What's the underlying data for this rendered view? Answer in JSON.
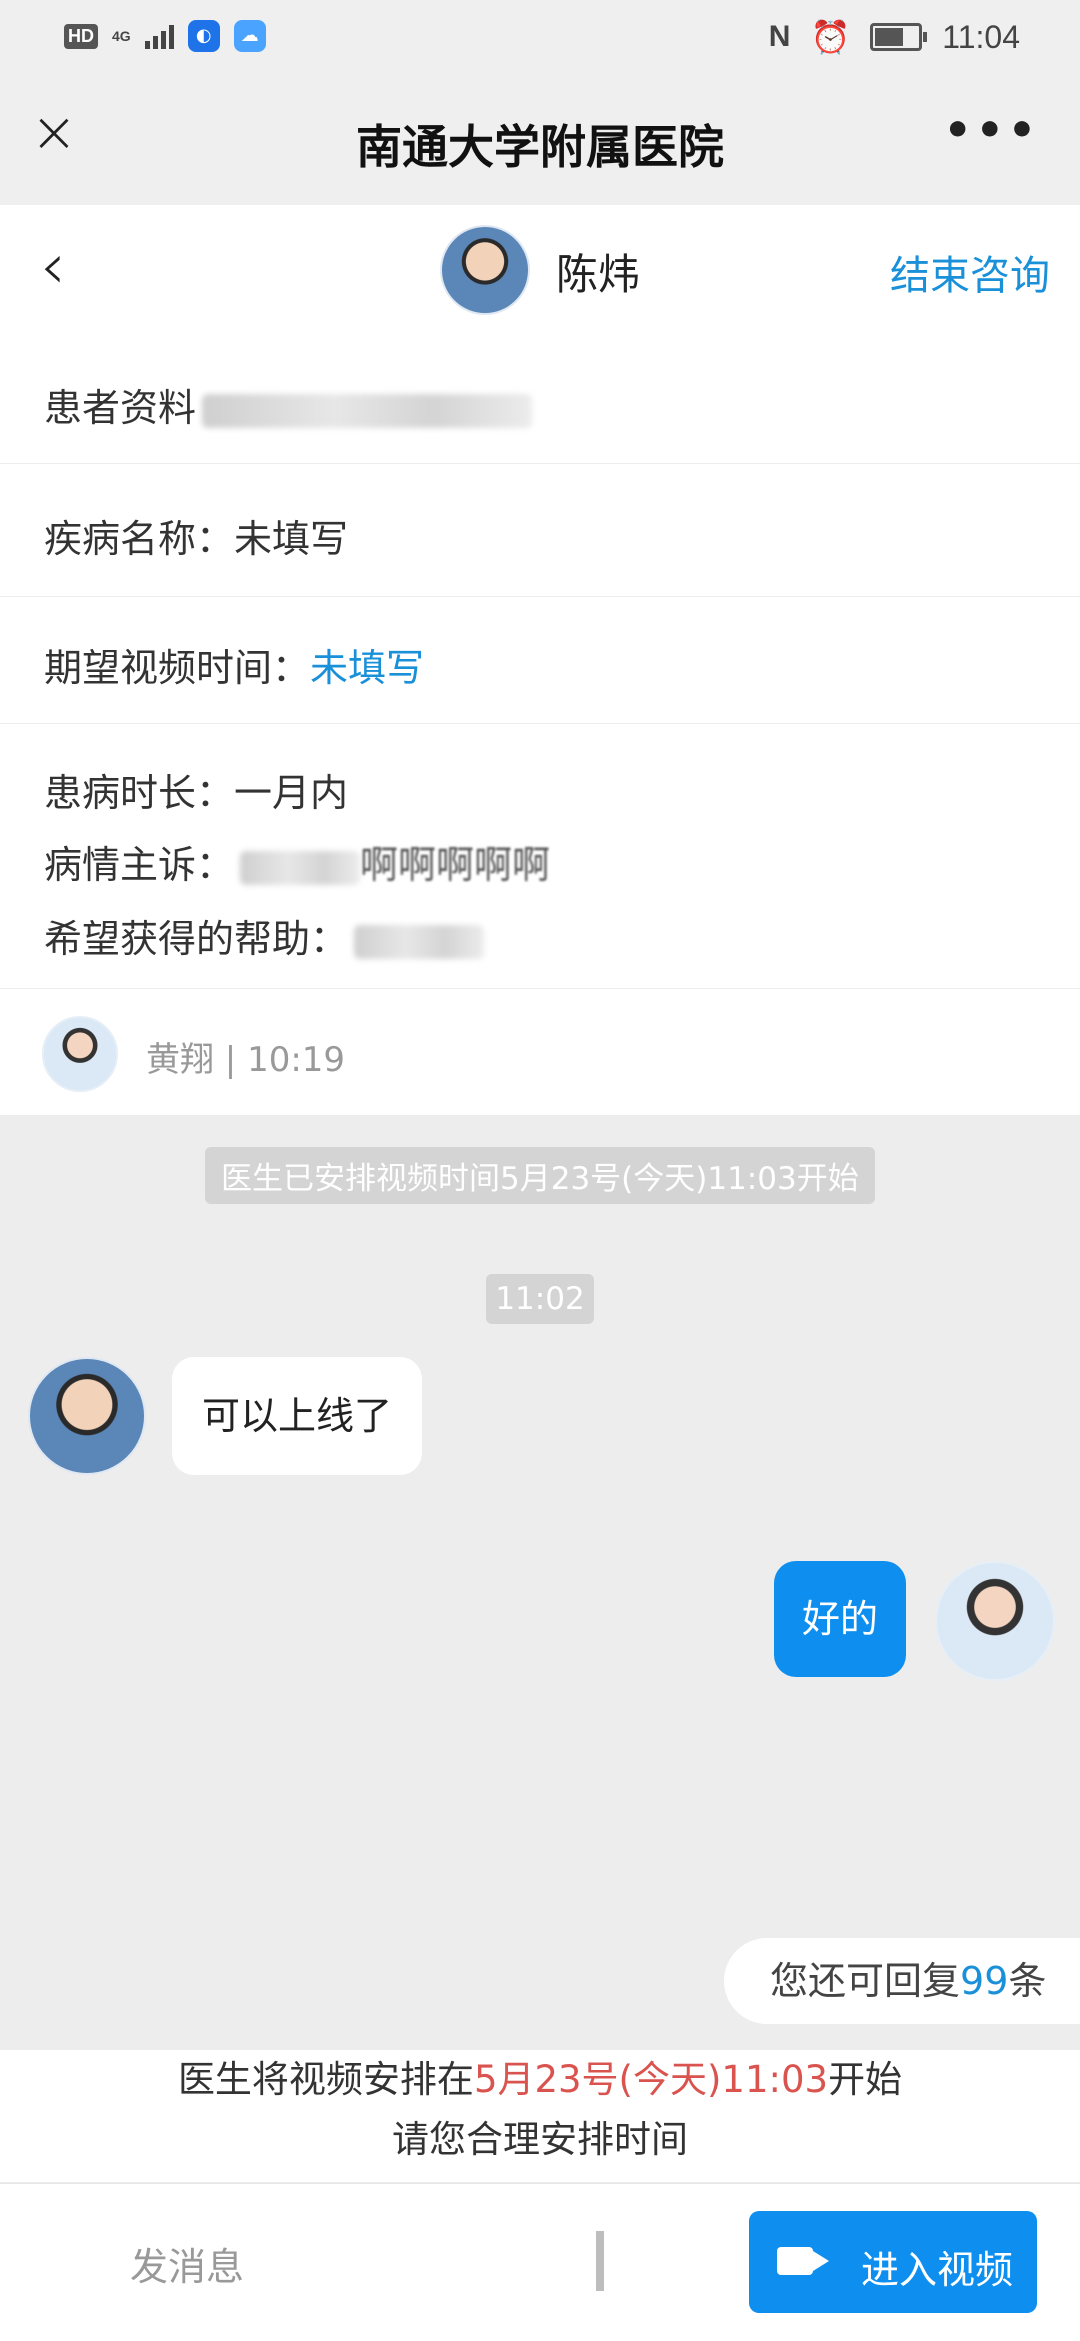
{
  "status_bar": {
    "hd": "HD",
    "network": "4G",
    "nfc": "N",
    "alarm": "⏰",
    "time": "11:04"
  },
  "titlebar": {
    "close_glyph": "×",
    "title": "南通大学附属医院",
    "more_glyph": "•••"
  },
  "header": {
    "back_glyph": "‹",
    "doctor_name": "陈炜",
    "end_label": "结束咨询"
  },
  "info": {
    "patient_label": "患者资料",
    "disease_label": "疾病名称：",
    "disease_value": "未填写",
    "expected_label": "期望视频时间：",
    "expected_value": "未填写",
    "duration_label": "患病时长：",
    "duration_value": "一月内",
    "complaint_label": "病情主诉：",
    "complaint_value": "啊啊啊啊啊",
    "help_label": "希望获得的帮助：",
    "user_meta": "黄翔 | 10:19"
  },
  "chat": {
    "system_notice": "医生已安排视频时间5月23号(今天)11:03开始",
    "time_pill": "11:02",
    "doctor_msg": "可以上线了",
    "user_msg": "好的",
    "remaining_prefix": "您还可回复",
    "remaining_count": "99",
    "remaining_suffix": "条"
  },
  "schedule": {
    "line1_prefix": "医生将视频安排在",
    "line1_time": "5月23号(今天)11:03",
    "line1_suffix": "开始",
    "line2": "请您合理安排时间"
  },
  "input": {
    "placeholder": "发消息",
    "video_label": "进入视频"
  },
  "colors": {
    "accent": "#1a90d8",
    "button_blue": "#0e8ff0",
    "highlight_red": "#d9534f"
  },
  "icons": [
    "close-icon",
    "more-icon",
    "back-icon",
    "video-camera-icon",
    "alarm-icon",
    "battery-icon",
    "signal-icon"
  ]
}
